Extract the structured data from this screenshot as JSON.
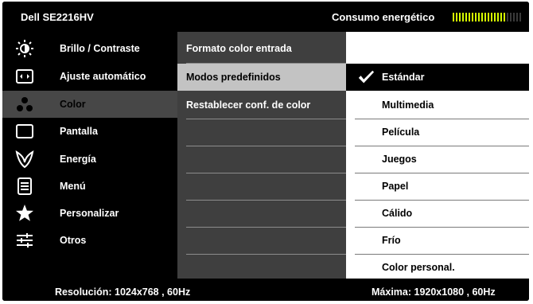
{
  "header": {
    "brand": "Dell SE2216HV",
    "energy_label": "Consumo energético",
    "energy_level": 0.78
  },
  "sidebar": {
    "items": [
      {
        "label": "Brillo / Contraste",
        "icon": "brightness-icon"
      },
      {
        "label": "Ajuste  automático",
        "icon": "auto-adjust-icon"
      },
      {
        "label": "Color",
        "icon": "color-icon",
        "active": true
      },
      {
        "label": "Pantalla",
        "icon": "display-icon"
      },
      {
        "label": "Energía",
        "icon": "energy-icon"
      },
      {
        "label": "Menú",
        "icon": "menu-icon"
      },
      {
        "label": "Personalizar",
        "icon": "star-icon"
      },
      {
        "label": "Otros",
        "icon": "sliders-icon"
      }
    ]
  },
  "submenu": {
    "items": [
      {
        "label": "Formato color entrada"
      },
      {
        "label": "Modos predefinidos",
        "selected": true
      },
      {
        "label": "Restablecer conf. de color"
      }
    ]
  },
  "options": {
    "items": [
      {
        "label": "Estándar",
        "selected": true
      },
      {
        "label": "Multimedia"
      },
      {
        "label": "Película"
      },
      {
        "label": "Juegos"
      },
      {
        "label": "Papel"
      },
      {
        "label": "Cálido"
      },
      {
        "label": "Frío"
      },
      {
        "label": "Color personal."
      }
    ]
  },
  "footer": {
    "resolution": "Resolución: 1024x768 , 60Hz",
    "max_resolution": "Máxima: 1920x1080 , 60Hz"
  },
  "colors": {
    "accent": "#d6ff00",
    "panel_dark": "#000000",
    "panel_mid": "#3f3f3f",
    "panel_light": "#ffffff",
    "selection_mid": "#c3c3c3"
  }
}
